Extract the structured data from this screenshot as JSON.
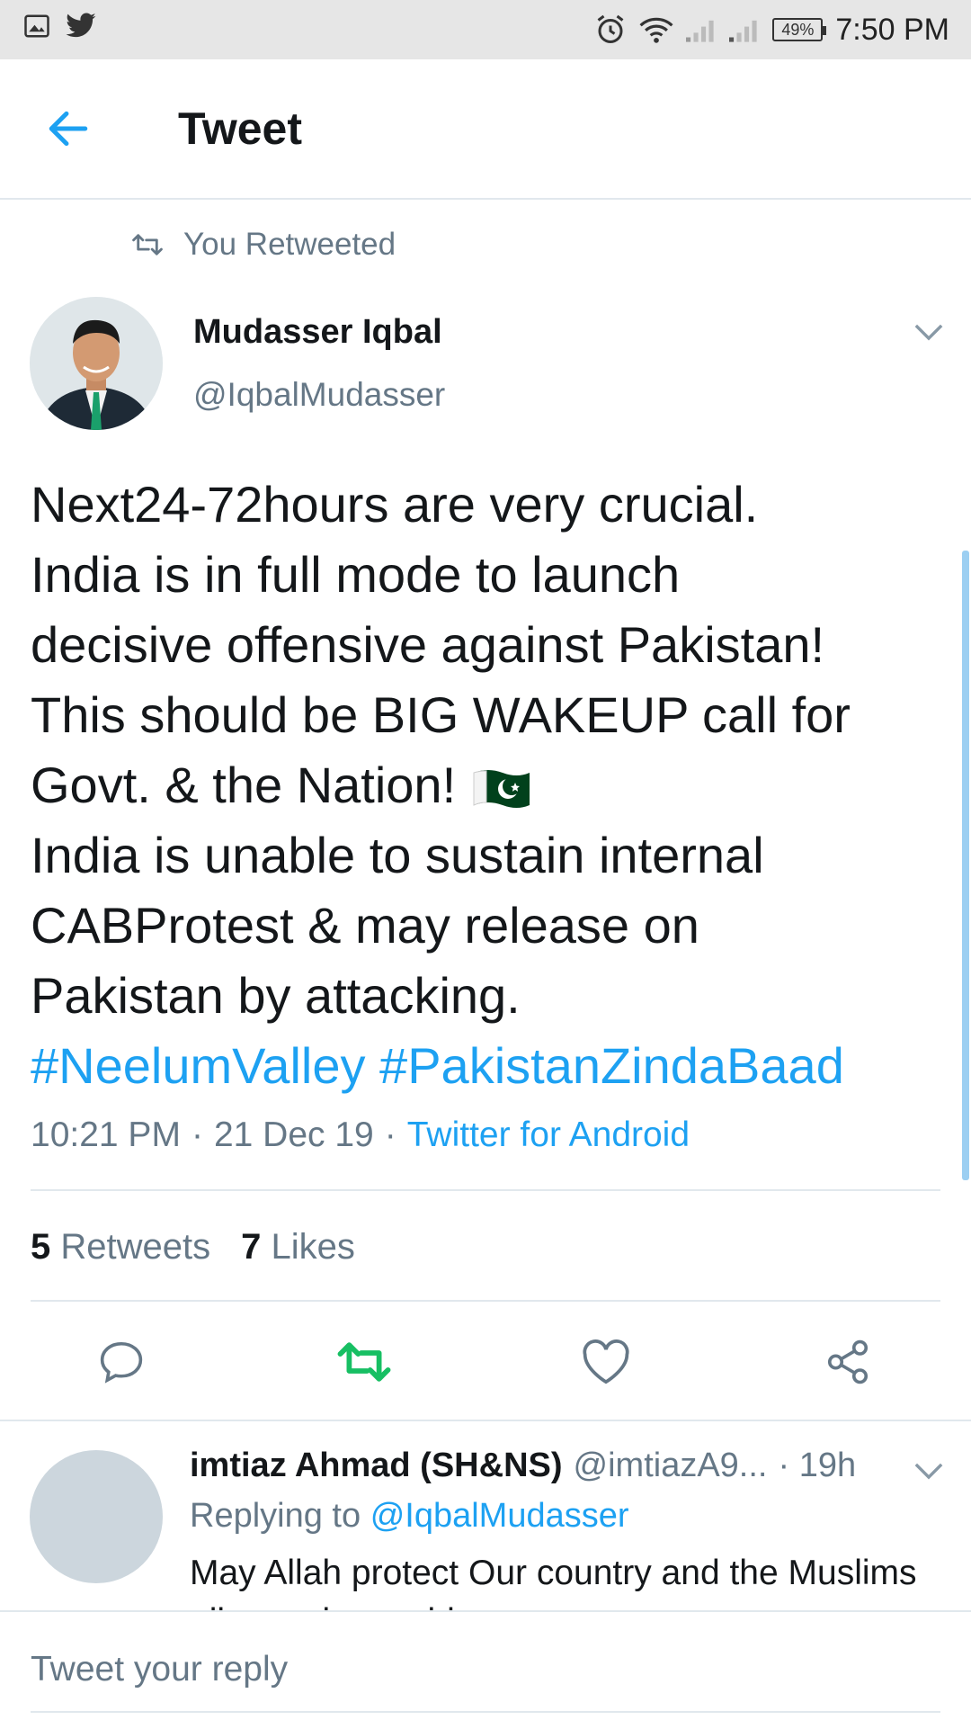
{
  "status_bar": {
    "time": "7:50 PM",
    "battery": "49%",
    "left_icons": [
      "gallery-icon",
      "twitter-bird-icon"
    ],
    "right_icons": [
      "alarm-icon",
      "wifi-icon",
      "signal-icon",
      "signal-icon-2"
    ]
  },
  "header": {
    "title": "Tweet"
  },
  "retweet_context": {
    "label": "You Retweeted"
  },
  "tweet": {
    "author_name": "Mudasser Iqbal",
    "author_handle": "@IqbalMudasser",
    "lines": [
      "Next24-72hours are very crucial.",
      "India is in full mode to launch",
      "decisive offensive against Pakistan!",
      "This should be BIG WAKEUP call for",
      "Govt. & the Nation!",
      "India is unable to sustain internal",
      "CABProtest & may release on",
      "Pakistan by attacking."
    ],
    "hashtags": [
      "#NeelumValley",
      "#PakistanZindaBaad"
    ],
    "time": "10:21 PM",
    "date": "21 Dec 19",
    "source": "Twitter for Android",
    "separator": "·",
    "retweets_count": "5",
    "retweets_label": "Retweets",
    "likes_count": "7",
    "likes_label": "Likes"
  },
  "reply": {
    "name": "imtiaz Ahmad (SH&NS)",
    "handle": "@imtiazA9...",
    "time": "· 19h",
    "replying_label": "Replying to",
    "replying_to": "@IqbalMudasser",
    "text": "May Allah protect Our country and the Muslims all over the world"
  },
  "composer": {
    "placeholder": "Tweet your reply"
  },
  "colors": {
    "accent": "#1da1f2",
    "retweeted": "#17bf63",
    "muted": "#657786",
    "divider": "#e1e8ed"
  }
}
